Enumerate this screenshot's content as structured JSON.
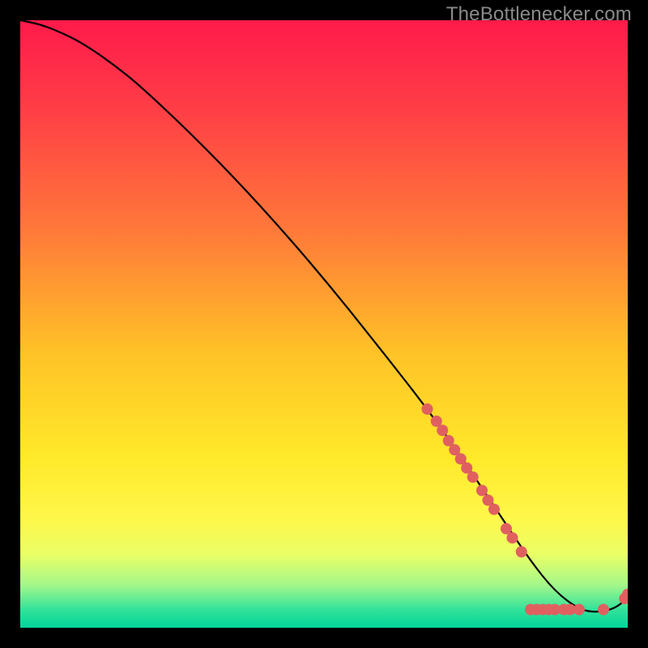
{
  "watermark": "TheBottlenecker.com",
  "chart_data": {
    "type": "line",
    "title": "",
    "xlabel": "",
    "ylabel": "",
    "xlim": [
      0,
      100
    ],
    "ylim": [
      0,
      100
    ],
    "grid": false,
    "legend": false,
    "background_gradient": {
      "stops": [
        {
          "offset": 0.0,
          "color": "#ff1a4b"
        },
        {
          "offset": 0.15,
          "color": "#ff3f46"
        },
        {
          "offset": 0.35,
          "color": "#ff7a39"
        },
        {
          "offset": 0.55,
          "color": "#ffc327"
        },
        {
          "offset": 0.72,
          "color": "#ffe92a"
        },
        {
          "offset": 0.82,
          "color": "#fff74a"
        },
        {
          "offset": 0.88,
          "color": "#e9ff66"
        },
        {
          "offset": 0.93,
          "color": "#a3f78a"
        },
        {
          "offset": 0.97,
          "color": "#33e29a"
        },
        {
          "offset": 1.0,
          "color": "#00d49a"
        }
      ]
    },
    "series": [
      {
        "name": "curve",
        "color": "#000000",
        "x": [
          0,
          3,
          6,
          10,
          15,
          20,
          30,
          40,
          50,
          60,
          67,
          72,
          76,
          80,
          84,
          88,
          92,
          95,
          98,
          100
        ],
        "y": [
          100,
          99.4,
          98.3,
          96.4,
          93,
          89,
          79.5,
          69,
          57.5,
          45,
          36,
          29,
          23,
          17,
          11,
          6,
          3,
          2.5,
          3.2,
          5
        ]
      }
    ],
    "markers": [
      {
        "name": "red-dots",
        "color": "#e06060",
        "radius": 7,
        "points": [
          {
            "x": 67.0,
            "y": 36.0
          },
          {
            "x": 68.5,
            "y": 34.0
          },
          {
            "x": 69.5,
            "y": 32.5
          },
          {
            "x": 70.5,
            "y": 30.8
          },
          {
            "x": 71.5,
            "y": 29.3
          },
          {
            "x": 72.5,
            "y": 27.8
          },
          {
            "x": 73.5,
            "y": 26.3
          },
          {
            "x": 74.5,
            "y": 24.8
          },
          {
            "x": 76.0,
            "y": 22.6
          },
          {
            "x": 77.0,
            "y": 21.0
          },
          {
            "x": 78.0,
            "y": 19.5
          },
          {
            "x": 80.0,
            "y": 16.3
          },
          {
            "x": 81.0,
            "y": 14.8
          },
          {
            "x": 82.5,
            "y": 12.5
          },
          {
            "x": 84.0,
            "y": 3.0
          },
          {
            "x": 85.0,
            "y": 3.0
          },
          {
            "x": 86.0,
            "y": 3.0
          },
          {
            "x": 87.0,
            "y": 3.0
          },
          {
            "x": 88.0,
            "y": 3.0
          },
          {
            "x": 89.5,
            "y": 3.0
          },
          {
            "x": 90.5,
            "y": 3.0
          },
          {
            "x": 92.0,
            "y": 3.0
          },
          {
            "x": 96.0,
            "y": 3.0
          },
          {
            "x": 99.5,
            "y": 4.8
          },
          {
            "x": 100.0,
            "y": 5.5
          }
        ]
      }
    ]
  }
}
